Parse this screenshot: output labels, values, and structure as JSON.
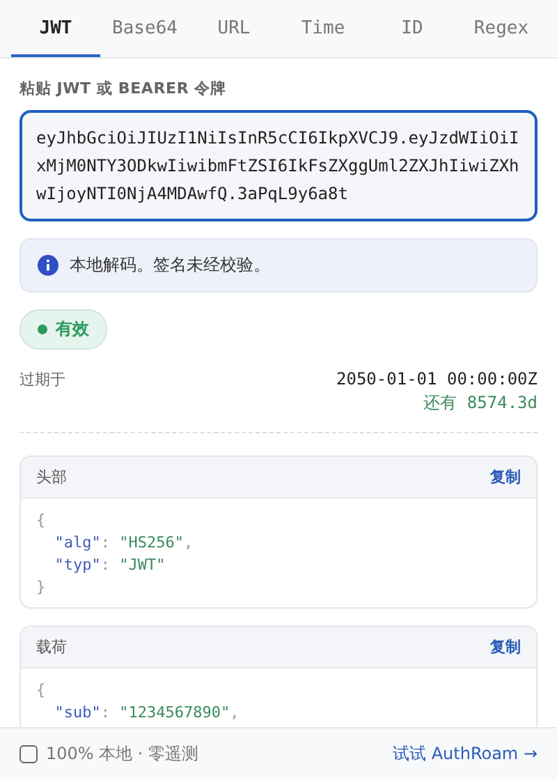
{
  "tabs": [
    {
      "label": "JWT",
      "selected": true
    },
    {
      "label": "Base64",
      "selected": false
    },
    {
      "label": "URL",
      "selected": false
    },
    {
      "label": "Time",
      "selected": false
    },
    {
      "label": "ID",
      "selected": false
    },
    {
      "label": "Regex",
      "selected": false
    }
  ],
  "input": {
    "label": "粘贴 JWT 或 BEARER 令牌",
    "value": "eyJhbGciOiJIUzI1NiIsInR5cCI6IkpXVCJ9.eyJzdWIiOiIxMjM0NTY3ODkwIiwibmFtZSI6IkFsZXggUml2ZXJhIiwiZXhwIjoyNTI0NjA4MDAwfQ.3aPqL9y6a8t"
  },
  "notice": {
    "text": "本地解码。签名未经校验。"
  },
  "status": {
    "label": "有效",
    "color": "#2e9a5e"
  },
  "expiry": {
    "label": "过期于",
    "value": "2050-01-01 00:00:00Z",
    "remaining": "还有 8574.3d"
  },
  "sections": [
    {
      "title": "头部",
      "action": "复制",
      "lines": [
        {
          "kind": "brace",
          "text": "{"
        },
        {
          "kind": "pair",
          "key": "\"alg\"",
          "sep": ":",
          "value": "\"HS256\"",
          "tail": ","
        },
        {
          "kind": "pair",
          "key": "\"typ\"",
          "sep": ":",
          "value": "\"JWT\""
        },
        {
          "kind": "brace",
          "text": "}"
        }
      ]
    },
    {
      "title": "载荷",
      "action": "复制",
      "lines": [
        {
          "kind": "brace",
          "text": "{"
        },
        {
          "kind": "pair",
          "key": "\"sub\"",
          "sep": ":",
          "value": "\"1234567890\"",
          "tail": ","
        }
      ]
    }
  ],
  "footer": {
    "checkbox": {
      "label": "100% 本地 · 零遥测",
      "checked": false
    },
    "link": "试试 AuthRoam →"
  }
}
